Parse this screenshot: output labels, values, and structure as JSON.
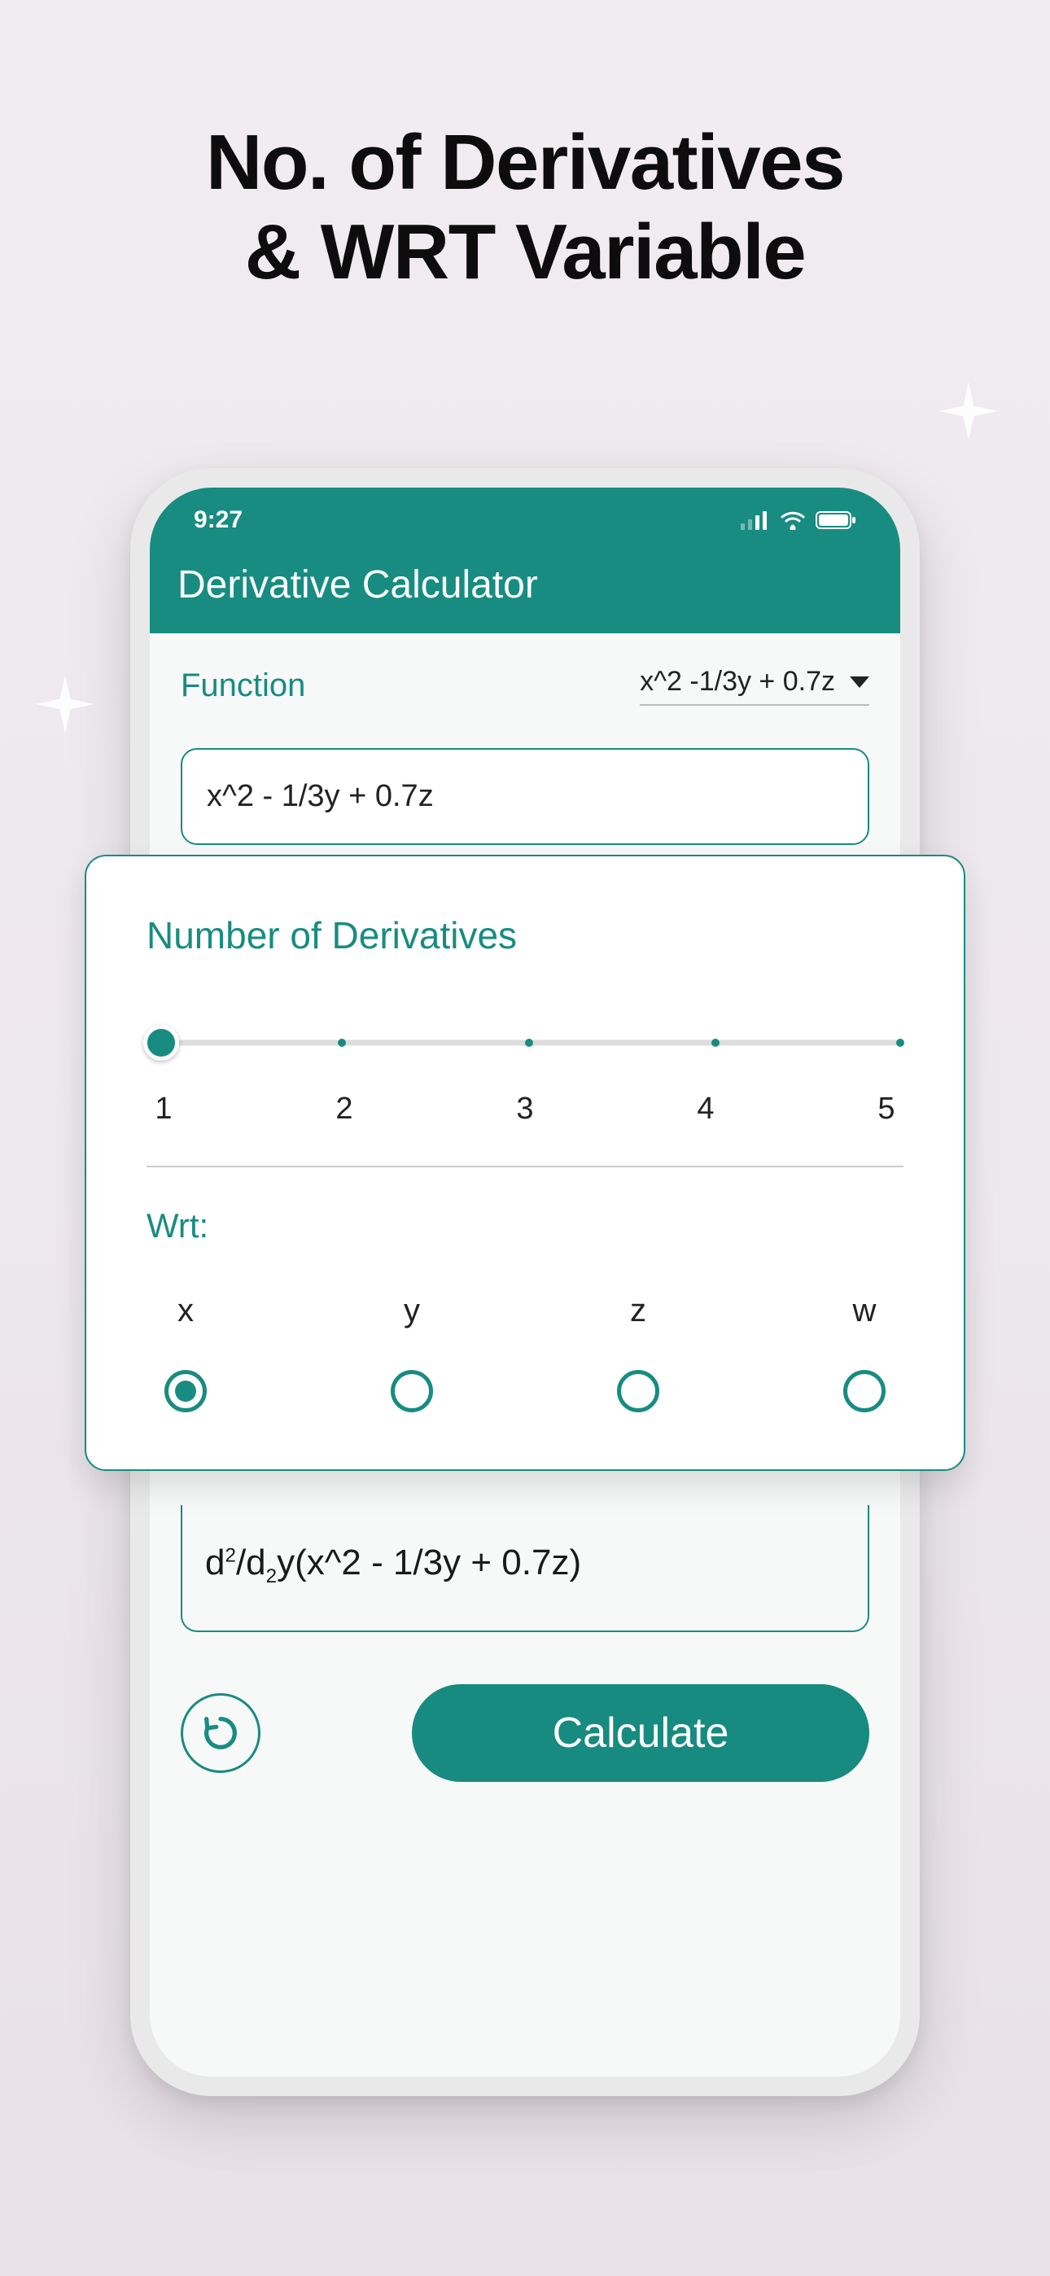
{
  "hero": {
    "line1": "No. of Derivatives",
    "line2": "& WRT Variable"
  },
  "status": {
    "time": "9:27"
  },
  "header": {
    "title": "Derivative Calculator"
  },
  "function_section": {
    "label": "Function",
    "dropdown_value": "x^2 -1/3y + 0.7z",
    "input_value": "x^2 - 1/3y + 0.7z"
  },
  "popover": {
    "title": "Number of Derivatives",
    "slider_value": 1,
    "slider_labels": [
      "1",
      "2",
      "3",
      "4",
      "5"
    ],
    "wrt_label": "Wrt:",
    "wrt_options": [
      "x",
      "y",
      "z",
      "w"
    ],
    "wrt_selected": "x"
  },
  "result": {
    "prefix": "d",
    "sup1": "2",
    "mid": "/d",
    "sub1": "2",
    "rest": "y(x^2 - 1/3y + 0.7z)"
  },
  "actions": {
    "calculate_label": "Calculate"
  },
  "colors": {
    "teal": "#188c81"
  }
}
